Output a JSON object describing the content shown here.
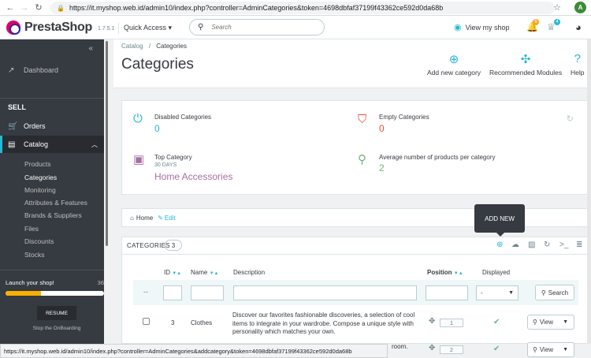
{
  "browser": {
    "url": "https://it.myshop.web.id/admin10/index.php?controller=AdminCategories&token=4698dbfaf37199f43362ce592d0da68b",
    "profile_initial": "A"
  },
  "header": {
    "logo_text": "PrestaShop",
    "version": "1.7.5.1",
    "quick_access": "Quick Access ▾",
    "search_placeholder": "Search",
    "view_shop": "View my shop",
    "orders_badge": "6",
    "customers_badge": "4"
  },
  "sidebar": {
    "dashboard": "Dashboard",
    "section_sell": "SELL",
    "orders": "Orders",
    "catalog": "Catalog",
    "catalog_items": [
      "Products",
      "Categories",
      "Monitoring",
      "Attributes & Features",
      "Brands & Suppliers",
      "Files",
      "Discounts",
      "Stocks"
    ],
    "active_item": "Categories",
    "launch_label": "Launch your shop!",
    "launch_percent": "36",
    "launch_progress": 0.36,
    "resume": "RESUME",
    "stop": "Stop the OnBoarding"
  },
  "page": {
    "breadcrumb_parent": "Catalog",
    "breadcrumb_sep": "/",
    "breadcrumb_current": "Categories",
    "title": "Categories",
    "toolbar": {
      "add_new": "Add new category",
      "modules": "Recommended Modules",
      "help": "Help"
    }
  },
  "kpis": {
    "disabled_label": "Disabled Categories",
    "disabled_value": "0",
    "empty_label": "Empty Categories",
    "empty_value": "0",
    "top_label": "Top Category",
    "top_sub": "30 DAYS",
    "top_value": "Home Accessories",
    "avg_label": "Average number of products per category",
    "avg_value": "2"
  },
  "tree": {
    "home": "Home",
    "edit": "Edit"
  },
  "table": {
    "title": "CATEGORIES",
    "count": "3",
    "tooltip": "ADD NEW",
    "headers": {
      "id": "ID",
      "name": "Name",
      "description": "Description",
      "position": "Position",
      "displayed": "Displayed"
    },
    "filter_dash": "--",
    "displayed_filter": "-",
    "search_button": "Search",
    "rows": [
      {
        "id": "3",
        "name": "Clothes",
        "description": "Discover our favorites fashionable discoveries, a selection of cool items to integrate in your wardrobe. Compose a unique style with personality which matches your own.",
        "position": "1",
        "view": "View"
      },
      {
        "id": "",
        "name": "",
        "description": "room.",
        "position": "2",
        "view": "View"
      }
    ]
  },
  "status_bar": "https://it.myshop.web.id/admin10/index.php?controller=AdminCategories&addcategory&token=4698dbfaf37199f43362ce592d0da68b",
  "colors": {
    "accent": "#25b9d7",
    "sidebar": "#363a41",
    "kpi_green": "#70b580",
    "kpi_red": "#f54c3e",
    "kpi_purple": "#a76fa3"
  }
}
